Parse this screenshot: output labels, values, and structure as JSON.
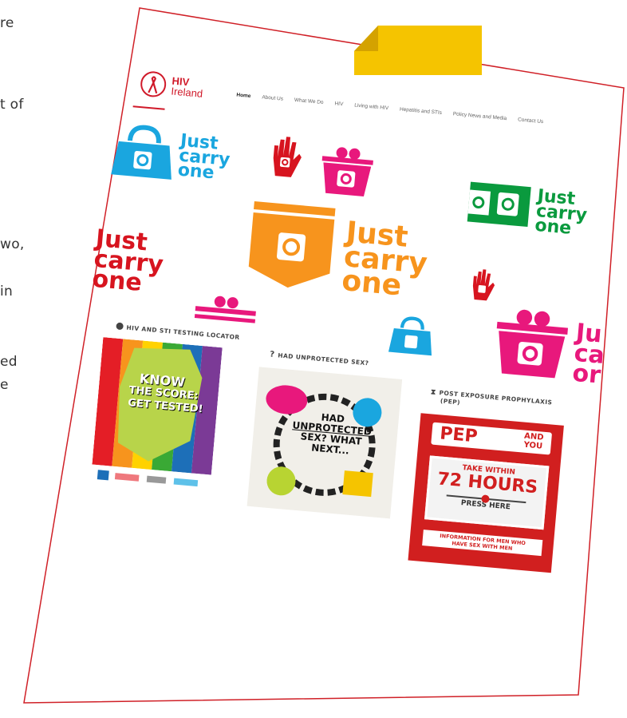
{
  "left_text_fragments": [
    "re",
    "t of",
    "wo,",
    "in",
    "ed",
    "e"
  ],
  "site": {
    "logo": {
      "line1": "HIV",
      "line2": "Ireland"
    },
    "nav_items": [
      {
        "label": "Home",
        "active": true
      },
      {
        "label": "About Us",
        "active": false
      },
      {
        "label": "What We Do",
        "active": false
      },
      {
        "label": "HIV",
        "active": false
      },
      {
        "label": "Living with HIV",
        "active": false
      },
      {
        "label": "Hepatitis and STIs",
        "active": false
      },
      {
        "label": "Policy News and Media",
        "active": false
      },
      {
        "label": "Contact Us",
        "active": false
      }
    ],
    "social_icons": [
      "facebook-icon",
      "twitter-icon"
    ]
  },
  "banner": {
    "slogan": {
      "line1": "Just",
      "line2": "carry",
      "line3": "one"
    },
    "partial_slogan": {
      "line1": "Ju",
      "line2": "ca",
      "line3": "or"
    }
  },
  "sections": [
    {
      "title": "HIV AND STI TESTING LOCATOR",
      "icon": "locator-icon",
      "poster": {
        "line1": "KNOW",
        "line2": "THE SCORE:",
        "line3": "GET TESTED!"
      }
    },
    {
      "title": "HAD UNPROTECTED SEX?",
      "icon": "question-icon",
      "poster": {
        "line1": "HAD",
        "line2": "UNPROTECTED",
        "line3": "SEX? WHAT",
        "line4": "NEXT..."
      }
    },
    {
      "title_line1": "POST EXPOSURE PROPHYLAXIS",
      "title_line2": "(PEP)",
      "icon": "hourglass-icon",
      "poster": {
        "pep": "PEP",
        "and_you_1": "AND",
        "and_you_2": "YOU",
        "take_within": "TAKE WITHIN",
        "hours": "72 HOURS",
        "press": "PRESS HERE",
        "info_1": "INFORMATION FOR MEN WHO",
        "info_2": "HAVE SEX WITH MEN"
      }
    }
  ],
  "colors": {
    "frame": "#d02027",
    "tape": "#f5c400",
    "blue": "#1aa6df",
    "pink": "#e8187c",
    "orange": "#f7941d",
    "green": "#0a9a3e",
    "red": "#d7141f"
  }
}
